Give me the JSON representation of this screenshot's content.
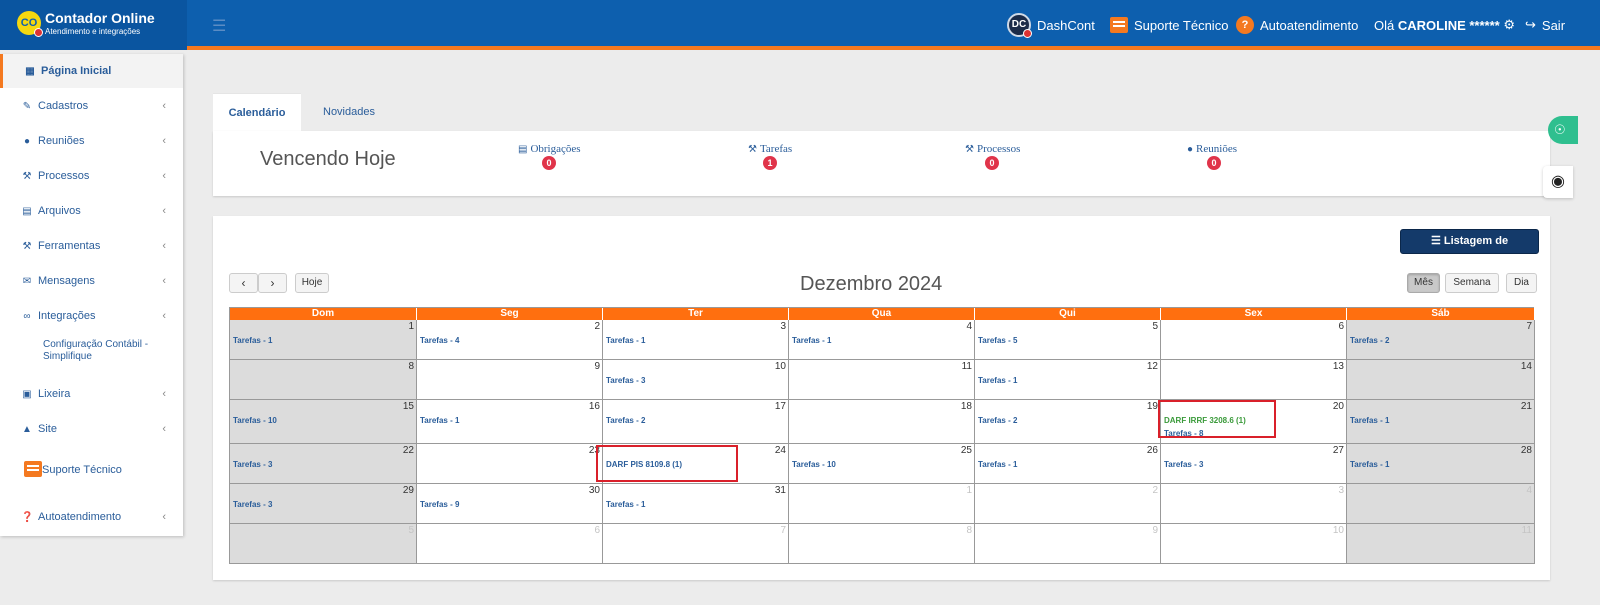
{
  "header": {
    "brand_logo_text": "CO",
    "brand_title": "Contador Online",
    "brand_subtitle": "Atendimento e integrações",
    "dashcont_icon_text": "DC",
    "dashcont_label": "DashCont",
    "suporte_label": "Suporte Técnico",
    "auto_icon_text": "?",
    "auto_label": "Autoatendimento",
    "greeting": "Olá",
    "user_name": "CAROLINE ******",
    "logout_label": "Sair"
  },
  "sidebar": {
    "items": [
      {
        "label": "Página Inicial",
        "icon": "dashboard-icon"
      },
      {
        "label": "Cadastros",
        "icon": "edit-icon"
      },
      {
        "label": "Reuniões",
        "icon": "users-icon"
      },
      {
        "label": "Processos",
        "icon": "gavel-icon"
      },
      {
        "label": "Arquivos",
        "icon": "file-icon"
      },
      {
        "label": "Ferramentas",
        "icon": "wrench-icon"
      },
      {
        "label": "Mensagens",
        "icon": "envelope-icon"
      },
      {
        "label": "Integrações",
        "icon": "link-icon"
      },
      {
        "label": "Lixeira",
        "icon": "trash-icon"
      },
      {
        "label": "Site",
        "icon": "sitemap-icon"
      },
      {
        "label": "Suporte Técnico",
        "icon": "chat-icon"
      },
      {
        "label": "Autoatendimento",
        "icon": "question-icon"
      }
    ],
    "subitem": "Configuração Contábil - Simplifique"
  },
  "tabs": [
    "Calendário",
    "Novidades"
  ],
  "vencendo": {
    "title": "Vencendo Hoje",
    "stats": [
      {
        "label": "Obrigações",
        "count": "0",
        "icon": "file-icon"
      },
      {
        "label": "Tarefas",
        "count": "1",
        "icon": "gavel-icon"
      },
      {
        "label": "Processos",
        "count": "0",
        "icon": "gavel-icon"
      },
      {
        "label": "Reuniões",
        "count": "0",
        "icon": "users-icon"
      }
    ]
  },
  "calendar": {
    "list_button": "Listagem de Obrigações",
    "today_button": "Hoje",
    "prev_icon": "chevron-left-icon",
    "next_icon": "chevron-right-icon",
    "month_title": "Dezembro 2024",
    "views": [
      "Mês",
      "Semana",
      "Dia"
    ],
    "active_view": "Mês",
    "weekdays": [
      "Dom",
      "Seg",
      "Ter",
      "Qua",
      "Qui",
      "Sex",
      "Sáb"
    ],
    "weeks": [
      [
        {
          "day": "1",
          "events": [
            "Tarefas - 1"
          ]
        },
        {
          "day": "2",
          "events": [
            "Tarefas - 4"
          ]
        },
        {
          "day": "3",
          "events": [
            "Tarefas - 1"
          ]
        },
        {
          "day": "4",
          "events": [
            "Tarefas - 1"
          ]
        },
        {
          "day": "5",
          "events": [
            "Tarefas - 5"
          ]
        },
        {
          "day": "6",
          "events": []
        },
        {
          "day": "7",
          "events": [
            "Tarefas - 2"
          ]
        }
      ],
      [
        {
          "day": "8",
          "events": []
        },
        {
          "day": "9",
          "events": []
        },
        {
          "day": "10",
          "events": [
            "Tarefas - 3"
          ]
        },
        {
          "day": "11",
          "events": []
        },
        {
          "day": "12",
          "events": [
            "Tarefas - 1"
          ]
        },
        {
          "day": "13",
          "events": []
        },
        {
          "day": "14",
          "events": []
        }
      ],
      [
        {
          "day": "15",
          "events": [
            "Tarefas - 10"
          ]
        },
        {
          "day": "16",
          "events": [
            "Tarefas - 1"
          ]
        },
        {
          "day": "17",
          "events": [
            "Tarefas - 2"
          ]
        },
        {
          "day": "18",
          "events": []
        },
        {
          "day": "19",
          "events": [
            "Tarefas - 2"
          ]
        },
        {
          "day": "20",
          "events": [
            "DARF IRRF 3208.6 (1)",
            "Tarefas - 8"
          ]
        },
        {
          "day": "21",
          "events": [
            "Tarefas - 1"
          ]
        }
      ],
      [
        {
          "day": "22",
          "events": [
            "Tarefas - 3"
          ]
        },
        {
          "day": "23",
          "events": []
        },
        {
          "day": "24",
          "events": [
            "DARF PIS 8109.8 (1)"
          ]
        },
        {
          "day": "25",
          "events": [
            "Tarefas - 10"
          ]
        },
        {
          "day": "26",
          "events": [
            "Tarefas - 1"
          ]
        },
        {
          "day": "27",
          "events": [
            "Tarefas - 3"
          ]
        },
        {
          "day": "28",
          "events": [
            "Tarefas - 1"
          ]
        }
      ],
      [
        {
          "day": "29",
          "events": [
            "Tarefas - 3"
          ]
        },
        {
          "day": "30",
          "events": [
            "Tarefas - 9"
          ]
        },
        {
          "day": "31",
          "events": [
            "Tarefas - 1"
          ]
        },
        {
          "day": "1",
          "events": [],
          "other": true
        },
        {
          "day": "2",
          "events": [],
          "other": true
        },
        {
          "day": "3",
          "events": [],
          "other": true
        },
        {
          "day": "4",
          "events": [],
          "other": true
        }
      ],
      [
        {
          "day": "5",
          "events": [],
          "other": true
        },
        {
          "day": "6",
          "events": [],
          "other": true
        },
        {
          "day": "7",
          "events": [],
          "other": true
        },
        {
          "day": "8",
          "events": [],
          "other": true
        },
        {
          "day": "9",
          "events": [],
          "other": true
        },
        {
          "day": "10",
          "events": [],
          "other": true
        },
        {
          "day": "11",
          "events": [],
          "other": true
        }
      ]
    ]
  },
  "colors": {
    "topbar": "#0d5fae",
    "accent_orange": "#f47920",
    "calendar_header": "#ff6f0f",
    "highlight_red": "#d9202a",
    "badge_red": "#e0344a",
    "link_blue": "#2a5d9a"
  }
}
